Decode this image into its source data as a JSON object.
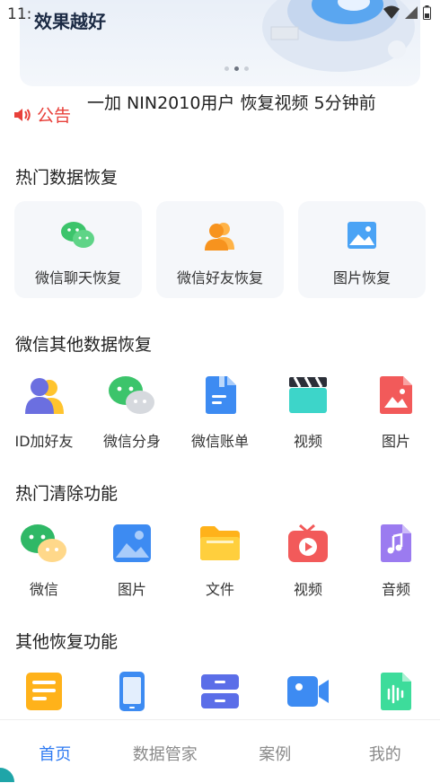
{
  "status_bar": {
    "time": "11:"
  },
  "banner": {
    "title": "效果越好"
  },
  "notice": {
    "label": "公告",
    "text": "一加 NIN2010用户 恢复视频 5分钟前"
  },
  "hot_recovery": {
    "title": "热门数据恢复",
    "items": [
      {
        "label": "微信聊天恢复",
        "icon": "wechat-chat-icon"
      },
      {
        "label": "微信好友恢复",
        "icon": "wechat-friends-icon"
      },
      {
        "label": "图片恢复",
        "icon": "picture-icon"
      }
    ]
  },
  "wechat_other": {
    "title": "微信其他数据恢复",
    "items": [
      {
        "label": "ID加好友",
        "icon": "id-add-friend-icon"
      },
      {
        "label": "微信分身",
        "icon": "wechat-clone-icon"
      },
      {
        "label": "微信账单",
        "icon": "wechat-bill-icon"
      },
      {
        "label": "视频",
        "icon": "video-clapper-icon"
      },
      {
        "label": "图片",
        "icon": "image-file-icon"
      }
    ]
  },
  "hot_clean": {
    "title": "热门清除功能",
    "items": [
      {
        "label": "微信",
        "icon": "wechat-icon"
      },
      {
        "label": "图片",
        "icon": "photo-icon"
      },
      {
        "label": "文件",
        "icon": "folder-icon"
      },
      {
        "label": "视频",
        "icon": "tv-play-icon"
      },
      {
        "label": "音频",
        "icon": "audio-file-icon"
      }
    ]
  },
  "other_recovery": {
    "title": "其他恢复功能",
    "icons": [
      "document-icon",
      "phone-icon",
      "storage-icon",
      "video-camera-icon",
      "voice-file-icon"
    ]
  },
  "tabs": [
    {
      "label": "首页",
      "active": true
    },
    {
      "label": "数据管家",
      "active": false
    },
    {
      "label": "案例",
      "active": false
    },
    {
      "label": "我的",
      "active": false
    }
  ],
  "colors": {
    "accent": "#2f7bf2",
    "notice": "#e8403a",
    "wechat_green": "#3cc46b"
  }
}
